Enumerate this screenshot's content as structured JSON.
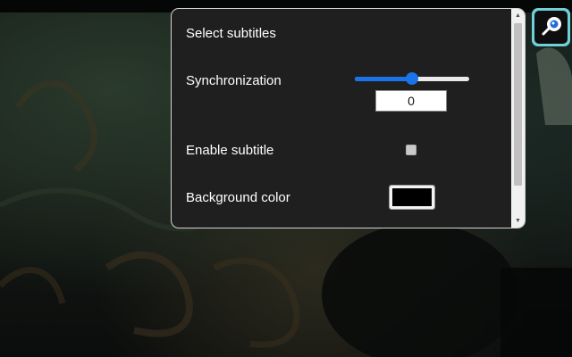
{
  "panel": {
    "title": "Select subtitles",
    "sync_label": "Synchronization",
    "sync_value": "0",
    "sync_slider_level": 0.5,
    "enable_subtitle_label": "Enable subtitle",
    "enable_subtitle_checked": false,
    "background_color_label": "Background color",
    "background_color": "#000000"
  },
  "colors": {
    "panel_bg": "#1f1f1f",
    "panel_border": "#d4d4d4",
    "accent": "#1a73e8",
    "extension_accent": "#6fd0d8"
  },
  "icons": {
    "extension": "subtitle-extension-icon",
    "scroll_up": "triangle-up-icon",
    "scroll_down": "triangle-down-icon"
  }
}
